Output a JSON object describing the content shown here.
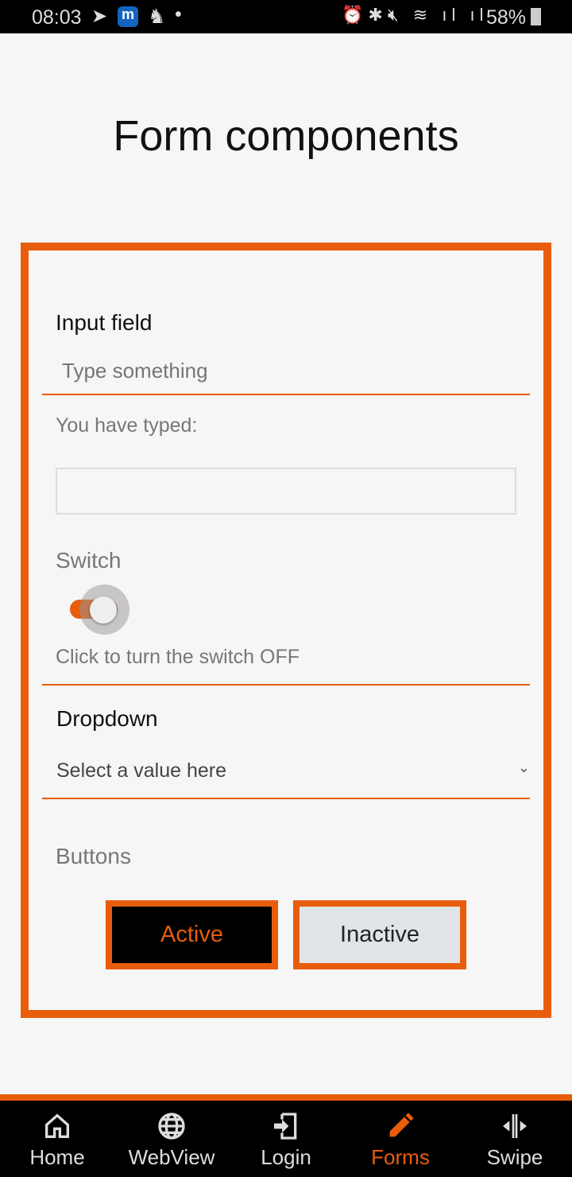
{
  "status": {
    "time": "08:03",
    "battery": "58%"
  },
  "title": "Form components",
  "input": {
    "label": "Input field",
    "placeholder": "Type something",
    "typed_label": "You have typed:",
    "typed_value": ""
  },
  "switch": {
    "label": "Switch",
    "state": "on",
    "hint": "Click to turn the switch OFF"
  },
  "dropdown": {
    "label": "Dropdown",
    "selected": "Select a value here"
  },
  "buttons": {
    "label": "Buttons",
    "active": "Active",
    "inactive": "Inactive"
  },
  "nav": [
    {
      "label": "Home",
      "icon": "home-icon"
    },
    {
      "label": "WebView",
      "icon": "globe-icon"
    },
    {
      "label": "Login",
      "icon": "login-icon"
    },
    {
      "label": "Forms",
      "icon": "pencil-icon",
      "active": true
    },
    {
      "label": "Swipe",
      "icon": "swipe-icon"
    }
  ],
  "colors": {
    "accent": "#e85d0c",
    "background": "#f6f6f6"
  }
}
